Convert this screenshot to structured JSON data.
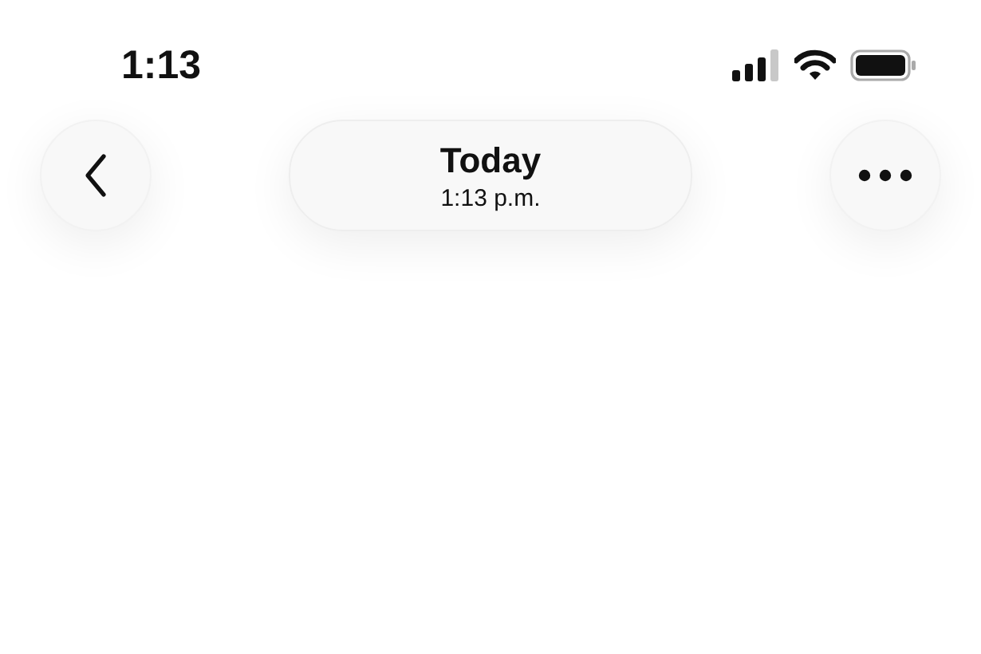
{
  "status_bar": {
    "time": "1:13"
  },
  "nav": {
    "title": "Today",
    "subtitle": "1:13 p.m."
  }
}
